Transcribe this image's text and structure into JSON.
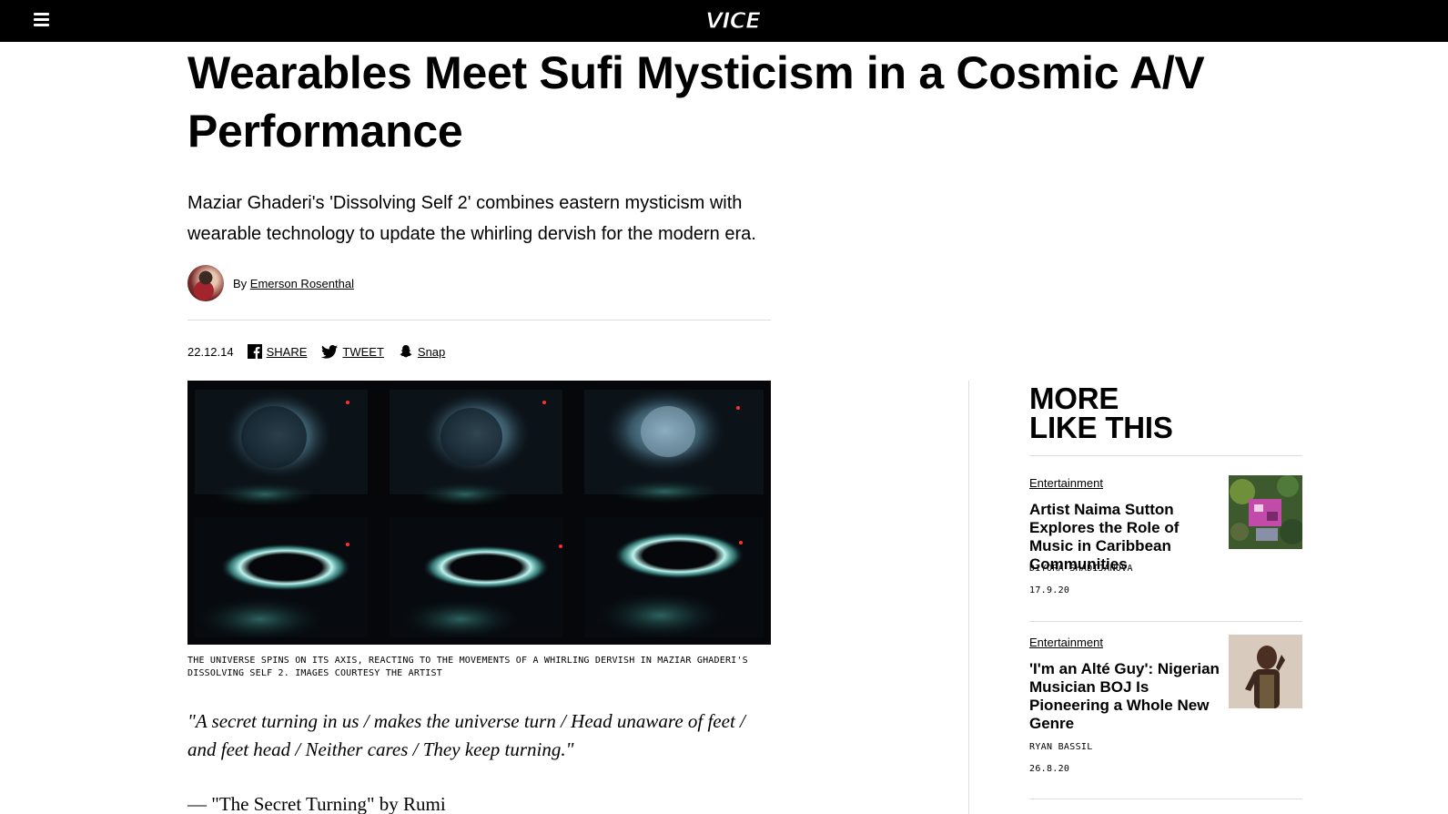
{
  "header": {
    "logo_text": "VICE",
    "menu_icon": "hamburger-menu-icon",
    "logo_icon": "vice-logo"
  },
  "article": {
    "title": "Wearables Meet Sufi Mysticism in a Cosmic A/V Performance",
    "dek": "Maziar Ghaderi's 'Dissolving Self 2' combines eastern mysticism with wearable technology to update the whirling dervish for the modern era.",
    "byline_prefix": "By",
    "author": "Emerson Rosenthal",
    "date": "22.12.14",
    "share": [
      {
        "label": "SHARE",
        "icon": "facebook-icon"
      },
      {
        "label": "TWEET",
        "icon": "twitter-icon"
      },
      {
        "label": "Snap",
        "icon": "snapchat-icon"
      }
    ],
    "caption": "The universe spins on its axis, reacting to the movements of a whirling dervish in Maziar Ghaderi's Dissolving Self 2. Images courtesy the artist",
    "quote": "\"A secret turning in us / makes the universe turn / Head unaware of feet / and feet head / Neither cares / They keep turning.\"",
    "attribution": "— \"The Secret Turning\" by Rumi"
  },
  "sidebar": {
    "title_line1": "MORE",
    "title_line2": "LIKE THIS",
    "cards": [
      {
        "category": "Entertainment",
        "title": "Artist Naima Sutton Explores the Role of Music in Caribbean Communities",
        "author": "DIYORA SHADIJANOVA",
        "date": "17.9.20"
      },
      {
        "category": "Entertainment",
        "title": "'I'm an Alté Guy': Nigerian Musician BOJ Is Pioneering a Whole New Genre",
        "author": "RYAN BASSIL",
        "date": "26.8.20"
      }
    ]
  },
  "colors": {
    "topbar": "#000000",
    "text": "#000000",
    "rule": "#dddddd",
    "hero_bg": "#05070a",
    "cyan_glow": "#7fe3dc"
  }
}
